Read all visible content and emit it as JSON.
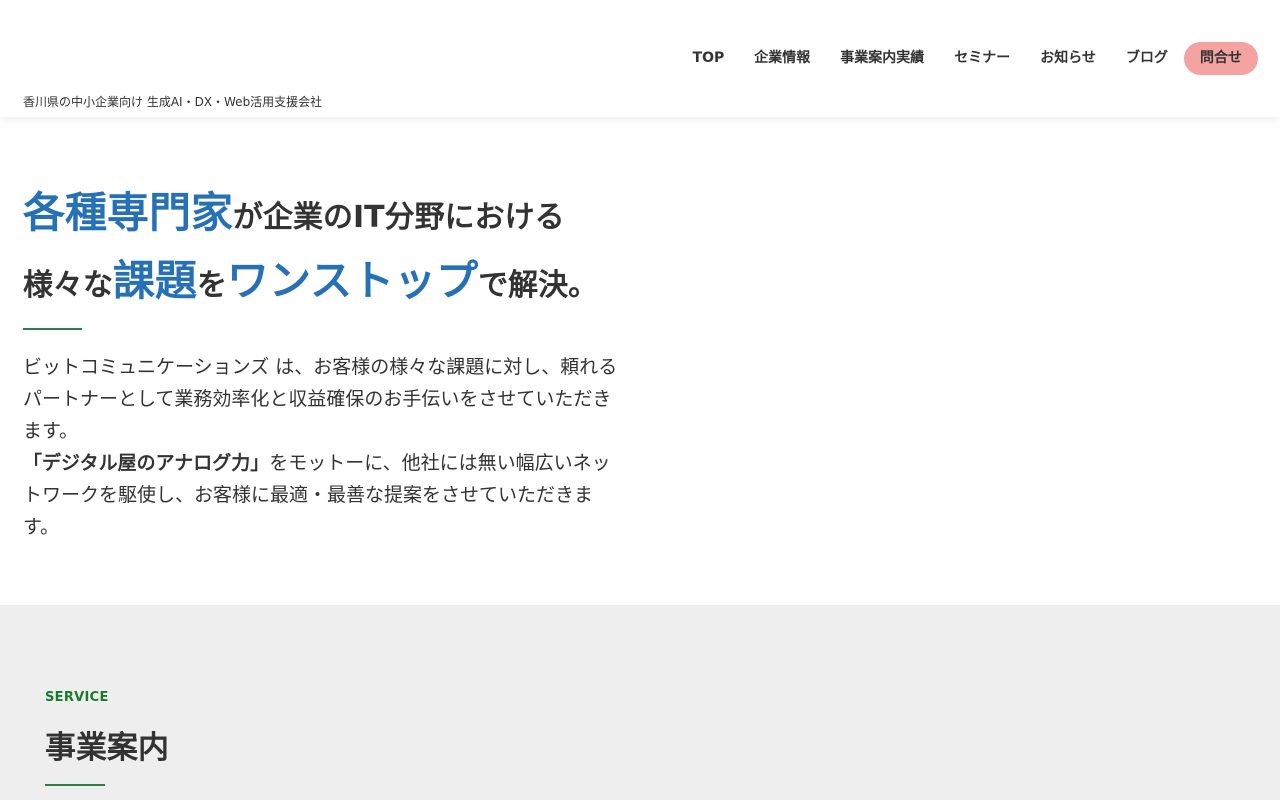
{
  "header": {
    "tagline": "香川県の中小企業向け 生成AI・DX・Web活用支援会社",
    "nav": [
      {
        "label": "TOP"
      },
      {
        "label": "企業情報"
      },
      {
        "label": "事業案内実績"
      },
      {
        "label": "セミナー"
      },
      {
        "label": "お知らせ"
      },
      {
        "label": "ブログ"
      },
      {
        "label": "問合せ"
      }
    ]
  },
  "hero": {
    "heading": {
      "line1_accent": "各種専門家",
      "line1_rest": "が企業のIT分野における",
      "line2_a": "様々な",
      "line2_accent1": "課題",
      "line2_b": "を",
      "line2_accent2": "ワンストップ",
      "line2_c": "で解決。"
    },
    "paragraph1": "ビットコミュニケーションズ は、お客様の様々な課題に対し、頼れるパートナーとして業務効率化と収益確保のお手伝いをさせていただきます。",
    "motto": "「デジタル屋のアナログ力」",
    "paragraph2": "をモットーに、他社には無い幅広いネットワークを駆使し、お客様に最適・最善な提案をさせていただきます。"
  },
  "service": {
    "label": "SERVICE",
    "title": "事業案内"
  },
  "colors": {
    "accent_blue": "#2670b5",
    "accent_green": "#1a7a2c",
    "contact_pink": "#f4a2a2"
  }
}
